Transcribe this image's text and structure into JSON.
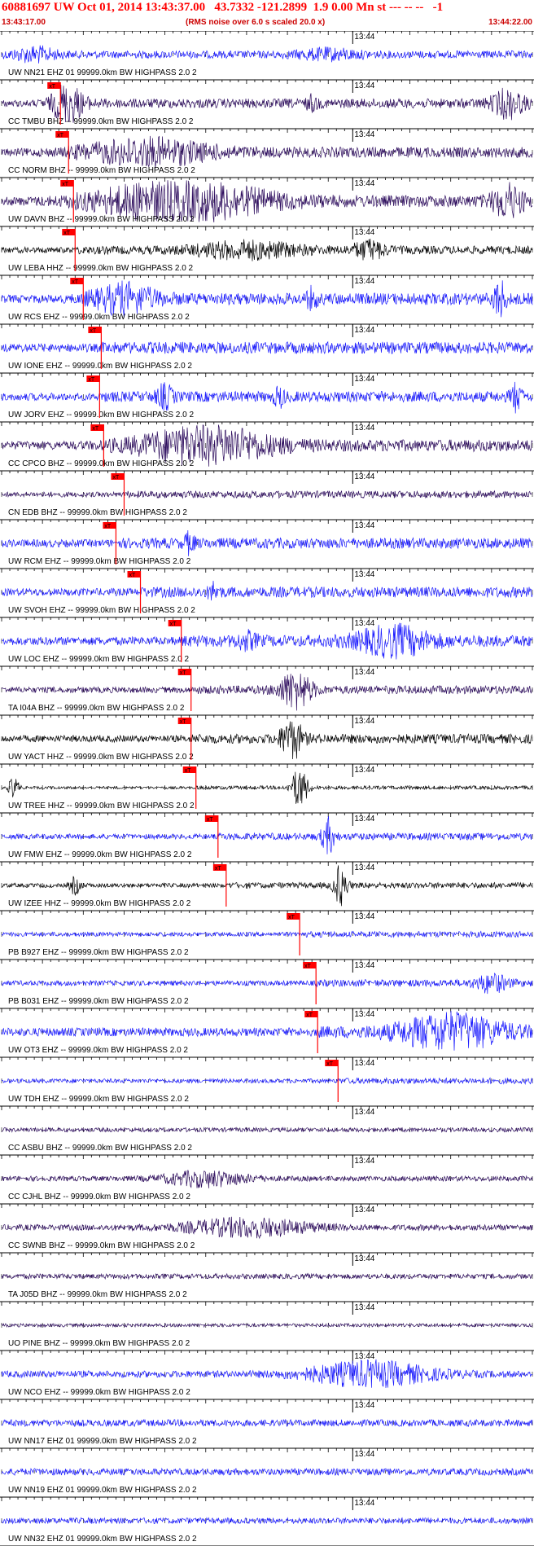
{
  "header": {
    "title": "60881697 UW Oct 01, 2014 13:43:37.00   43.7332 -121.2899  1.9 0.00 Mn st --- -- --   -1",
    "start_time": "13:43:17.00",
    "subtitle": "(RMS noise over 6.0 s scaled 20.0 x)",
    "end_time": "13:44:22.00"
  },
  "minute_label": "13:44",
  "pick_label": "xT",
  "colors": {
    "blue": "#1a1aff",
    "navy": "#2b0a5c",
    "black": "#000000",
    "pick": "#ff0000",
    "title": "#ff0000"
  },
  "traces": [
    {
      "label": "UW NN21 EHZ 01 99999.0km BW  HIGHPASS  2.0  2",
      "color": "blue",
      "amp": 0.18,
      "pick_s": null,
      "bursts": [
        [
          4,
          4,
          0.3
        ],
        [
          40,
          6,
          0.2
        ]
      ]
    },
    {
      "label": "CC TMBU BHZ -- 99999.0km BW  HIGHPASS  2.0  2",
      "color": "navy",
      "amp": 0.16,
      "pick_s": 7.2,
      "bursts": [
        [
          8,
          3,
          0.9
        ],
        [
          62,
          3,
          0.6
        ],
        [
          38,
          1,
          0.3
        ]
      ]
    },
    {
      "label": "CC NORM BHZ -- 99999.0km BW  HIGHPASS  2.0  2",
      "color": "navy",
      "amp": 0.18,
      "pick_s": 8.2,
      "bursts": [
        [
          18,
          12,
          0.55
        ]
      ]
    },
    {
      "label": "UW DAVN BHZ -- 99999.0km BW  HIGHPASS  2.0  2",
      "color": "navy",
      "amp": 0.2,
      "pick_s": 8.8,
      "bursts": [
        [
          22,
          16,
          0.9
        ],
        [
          62,
          3,
          0.7
        ]
      ]
    },
    {
      "label": "UW LEBA HHZ -- 99999.0km BW  HIGHPASS  2.0  2",
      "color": "black",
      "amp": 0.14,
      "pick_s": 9.0,
      "bursts": [
        [
          30,
          10,
          0.35
        ],
        [
          45,
          3,
          0.4
        ]
      ]
    },
    {
      "label": "UW RCS EHZ -- 99999.0km BW  HIGHPASS  2.0  2",
      "color": "blue",
      "amp": 0.2,
      "pick_s": 10.0,
      "bursts": [
        [
          15,
          6,
          0.6
        ],
        [
          61,
          1,
          1.0
        ],
        [
          38,
          1,
          0.4
        ]
      ]
    },
    {
      "label": "UW IONE EHZ -- 99999.0km BW  HIGHPASS  2.0  2",
      "color": "blue",
      "amp": 0.2,
      "pick_s": 12.2,
      "bursts": []
    },
    {
      "label": "UW JORV EHZ -- 99999.0km BW  HIGHPASS  2.0  2",
      "color": "blue",
      "amp": 0.18,
      "pick_s": 12.0,
      "bursts": [
        [
          20,
          1.5,
          0.5
        ],
        [
          34,
          1,
          0.4
        ],
        [
          63,
          1,
          0.6
        ]
      ]
    },
    {
      "label": "CC CPCO BHZ -- 99999.0km BW  HIGHPASS  2.0  2",
      "color": "navy",
      "amp": 0.2,
      "pick_s": 12.5,
      "bursts": [
        [
          25,
          12,
          0.85
        ]
      ]
    },
    {
      "label": "CN EDB BHZ -- 99999.0km BW  HIGHPASS  2.0  2",
      "color": "navy",
      "amp": 0.12,
      "pick_s": 15.0,
      "bursts": []
    },
    {
      "label": "UW RCM EHZ -- 99999.0km BW  HIGHPASS  2.0  2",
      "color": "blue",
      "amp": 0.18,
      "pick_s": 14.0,
      "bursts": [
        [
          23,
          1,
          0.4
        ]
      ]
    },
    {
      "label": "UW SVOH EHZ -- 99999.0km BW  HIGHPASS  2.0  2",
      "color": "blue",
      "amp": 0.18,
      "pick_s": 17.0,
      "bursts": [
        [
          26,
          1,
          0.35
        ]
      ]
    },
    {
      "label": "UW LOC EHZ -- 99999.0km BW  HIGHPASS  2.0  2",
      "color": "blue",
      "amp": 0.2,
      "pick_s": 22.0,
      "bursts": [
        [
          48,
          7,
          0.6
        ],
        [
          30,
          2,
          0.3
        ]
      ]
    },
    {
      "label": "TA I04A BHZ -- 99999.0km BW  HIGHPASS  2.0  2",
      "color": "navy",
      "amp": 0.14,
      "pick_s": 23.2,
      "bursts": [
        [
          36,
          3,
          0.9
        ]
      ]
    },
    {
      "label": "UW YACT HHZ -- 99999.0km BW  HIGHPASS  2.0  2",
      "color": "black",
      "amp": 0.16,
      "pick_s": 23.2,
      "bursts": [
        [
          35.5,
          2,
          1.0
        ]
      ]
    },
    {
      "label": "UW TREE HHZ -- 99999.0km BW  HIGHPASS  2.0  2",
      "color": "black",
      "amp": 0.06,
      "pick_s": 23.8,
      "bursts": [
        [
          36.5,
          1.5,
          1.0
        ],
        [
          1.5,
          1,
          0.5
        ]
      ]
    },
    {
      "label": "UW FMW EHZ -- 99999.0km BW  HIGHPASS  2.0  2",
      "color": "blue",
      "amp": 0.12,
      "pick_s": 26.5,
      "bursts": [
        [
          40,
          1.2,
          0.8
        ]
      ]
    },
    {
      "label": "UW IZEE HHZ -- 99999.0km BW  HIGHPASS  2.0  2",
      "color": "black",
      "amp": 0.1,
      "pick_s": 27.5,
      "bursts": [
        [
          41.5,
          1.2,
          1.0
        ],
        [
          9,
          1,
          0.4
        ]
      ]
    },
    {
      "label": "PB B927 EHZ -- 99999.0km BW  HIGHPASS  2.0  2",
      "color": "blue",
      "amp": 0.1,
      "pick_s": 36.5,
      "bursts": []
    },
    {
      "label": "PB B031 EHZ -- 99999.0km BW  HIGHPASS  2.0  2",
      "color": "blue",
      "amp": 0.12,
      "pick_s": 38.5,
      "bursts": [
        [
          60,
          3,
          0.4
        ]
      ]
    },
    {
      "label": "UW OT3 EHZ -- 99999.0km BW  HIGHPASS  2.0  2",
      "color": "blue",
      "amp": 0.2,
      "pick_s": 38.7,
      "bursts": [
        [
          55,
          10,
          0.75
        ]
      ]
    },
    {
      "label": "UW TDH EHZ -- 99999.0km BW  HIGHPASS  2.0  2",
      "color": "blue",
      "amp": 0.1,
      "pick_s": 41.2,
      "bursts": []
    },
    {
      "label": "CC ASBU BHZ -- 99999.0km BW  HIGHPASS  2.0  2",
      "color": "navy",
      "amp": 0.1,
      "pick_s": null,
      "bursts": []
    },
    {
      "label": "CC CJHL BHZ -- 99999.0km BW  HIGHPASS  2.0  2",
      "color": "navy",
      "amp": 0.12,
      "pick_s": null,
      "bursts": [
        [
          25,
          8,
          0.35
        ]
      ]
    },
    {
      "label": "CC SWNB BHZ -- 99999.0km BW  HIGHPASS  2.0  2",
      "color": "navy",
      "amp": 0.14,
      "pick_s": null,
      "bursts": [
        [
          30,
          12,
          0.4
        ]
      ]
    },
    {
      "label": "TA J05D BHZ -- 99999.0km BW  HIGHPASS  2.0  2",
      "color": "navy",
      "amp": 0.12,
      "pick_s": null,
      "bursts": []
    },
    {
      "label": "UO PINE BHZ -- 99999.0km BW  HIGHPASS  2.0  2",
      "color": "navy",
      "amp": 0.08,
      "pick_s": null,
      "bursts": []
    },
    {
      "label": "UW NCO EHZ -- 99999.0km BW  HIGHPASS  2.0  2",
      "color": "blue",
      "amp": 0.16,
      "pick_s": null,
      "bursts": [
        [
          45,
          12,
          0.55
        ]
      ]
    },
    {
      "label": "UW NN17 EHZ 01 99999.0km BW  HIGHPASS  2.0  2",
      "color": "blue",
      "amp": 0.16,
      "pick_s": null,
      "bursts": []
    },
    {
      "label": "UW NN19 EHZ 01 99999.0km BW  HIGHPASS  2.0  2",
      "color": "blue",
      "amp": 0.16,
      "pick_s": null,
      "bursts": []
    },
    {
      "label": "UW NN32 EHZ 01 99999.0km BW  HIGHPASS  2.0  2",
      "color": "blue",
      "amp": 0.14,
      "pick_s": null,
      "bursts": []
    }
  ]
}
